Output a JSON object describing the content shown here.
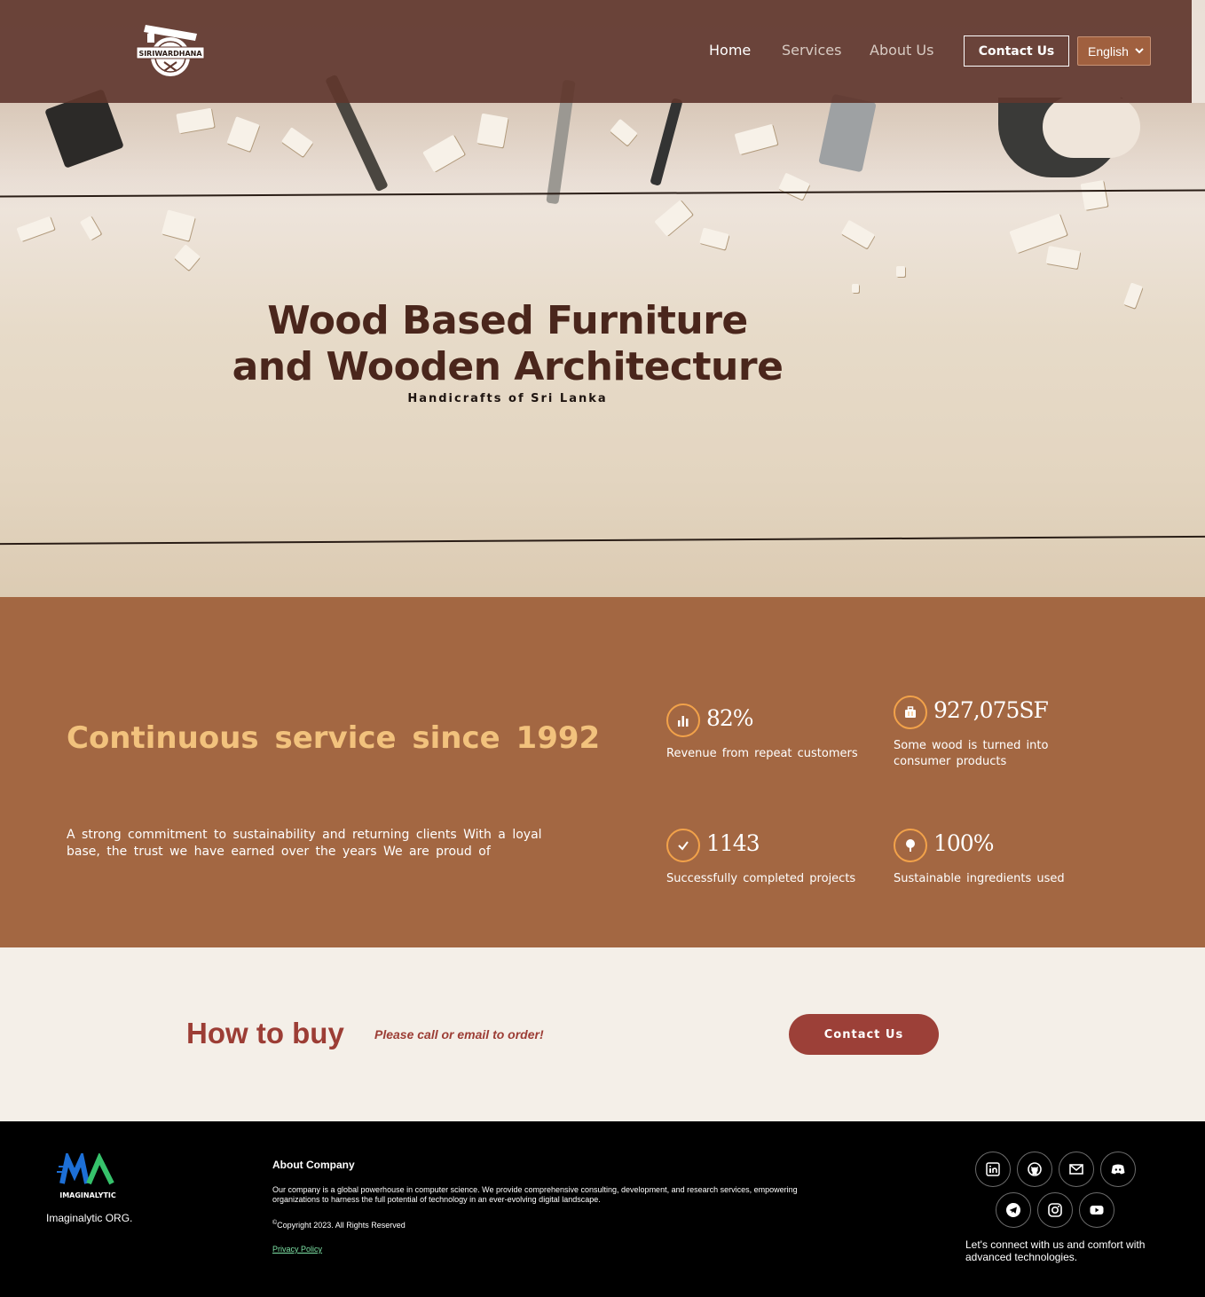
{
  "header": {
    "logo_text": "SIRIWARDHANA",
    "nav": {
      "home": "Home",
      "services": "Services",
      "about": "About Us"
    },
    "contact_label": "Contact Us",
    "language": "English"
  },
  "hero": {
    "title_line1": "Wood Based Furniture",
    "title_line2": "and Wooden Architecture",
    "subtitle": "Handicrafts of Sri Lanka"
  },
  "stats": {
    "heading": "Continuous service since 1992",
    "text": "A strong commitment to sustainability and returning clients With a loyal base, the trust we have earned over the years We are proud of",
    "items": [
      {
        "value": "82%",
        "label": "Revenue from repeat customers",
        "icon": "bar-chart-icon"
      },
      {
        "value": "927,075SF",
        "label": "Some wood is turned into consumer products",
        "icon": "briefcase-icon"
      },
      {
        "value": "1143",
        "label": "Successfully completed projects",
        "icon": "check-icon"
      },
      {
        "value": "100%",
        "label": "Sustainable ingredients used",
        "icon": "tree-icon"
      }
    ]
  },
  "buy": {
    "title": "How to buy",
    "subtitle": "Please call or email to order!",
    "button": "Contact Us"
  },
  "footer": {
    "logo_text": "IMAGINALYTIC",
    "org_name": "Imaginalytic ORG.",
    "about_heading": "About Company",
    "about_text": "Our company is a global powerhouse in computer science. We provide comprehensive consulting, development, and research services, empowering organizations to harness the full potential of technology in an ever-evolving digital landscape.",
    "copyright_symbol": "©",
    "copyright": "Copyright 2023. All Rights Reserved",
    "privacy": "Privacy Policy",
    "connect_text": "Let's connect with us and comfort with advanced technologies.",
    "social": [
      "linkedin-icon",
      "github-icon",
      "mail-icon",
      "discord-icon",
      "telegram-icon",
      "instagram-icon",
      "youtube-icon"
    ]
  },
  "colors": {
    "nav_bg": "#60372d",
    "stats_bg": "#a36742",
    "accent_gold": "#f2c27d",
    "icon_ring": "#f2a24a",
    "buy_red": "#9c3d35",
    "footer_bg": "#000000"
  }
}
